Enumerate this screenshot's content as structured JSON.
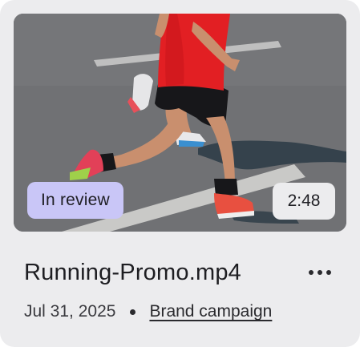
{
  "card": {
    "status_badge": "In review",
    "duration": "2:48",
    "title": "Running-Promo.mp4",
    "date": "Jul 31, 2025",
    "collection": "Brand campaign",
    "more_icon": "more-horizontal-icon"
  },
  "colors": {
    "card_bg": "#ececee",
    "status_badge_bg": "#c9c6f7",
    "duration_badge_bg": "#ececee",
    "text": "#1e1e22"
  }
}
